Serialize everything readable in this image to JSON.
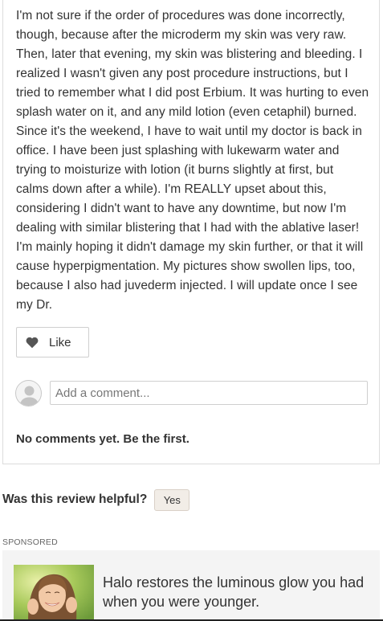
{
  "review": {
    "body": "I'm not sure if the order of procedures was done incorrectly, though, because after the microderm my skin was very raw. Then, later that evening, my skin was blistering and bleeding. I realized I wasn't given any post procedure instructions, but I tried to remember what I did post Erbium. It was hurting to even splash water on it, and any mild lotion (even cetaphil) burned. Since it's the weekend, I have to wait until my doctor is back in office. I have been just splashing with lukewarm water and trying to moisturize with lotion (it burns slightly at first, but calms down after a while). I'm REALLY upset about this, considering I didn't want to have any downtime, but now I'm dealing with similar blistering that I had with the ablative laser! I'm mainly hoping it didn't damage my skin further, or that it will cause hyperpigmentation. My pictures show swollen lips, too, because I also had juvederm injected. I will update once I see my Dr.",
    "like_label": "Like",
    "like_icon": "heart-icon"
  },
  "comments": {
    "placeholder": "Add a comment...",
    "empty_message": "No comments yet. Be the first."
  },
  "helpful": {
    "question": "Was this review helpful?",
    "yes_label": "Yes"
  },
  "sponsored": {
    "label": "SPONSORED",
    "ad_text": "Halo restores the luminous glow you had when you were younger."
  },
  "colors": {
    "text": "#333333",
    "border": "#dcdcdc",
    "yes_button_bg": "#f2ede7",
    "ad_bg": "#f4f4f4"
  }
}
